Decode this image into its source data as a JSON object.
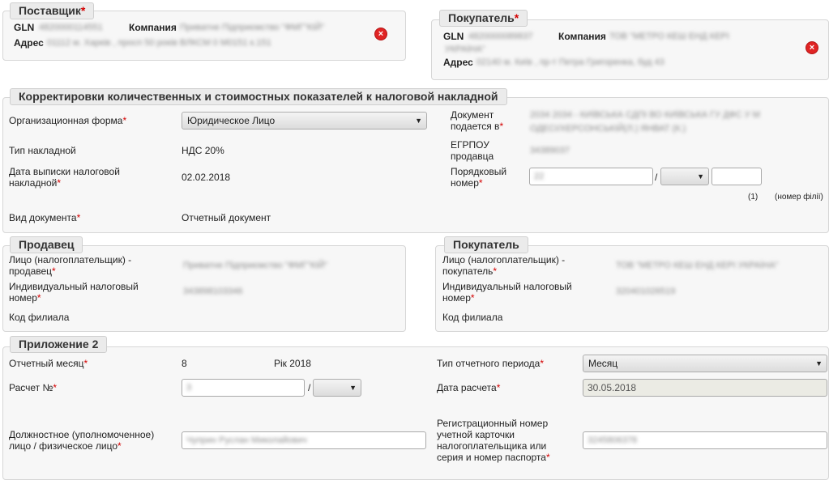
{
  "supplier": {
    "legend": "Поставщик",
    "gln_label": "GLN",
    "gln_value": "4820000114551",
    "company_label": "Компания",
    "company_value": "Приватне Підприємство \"ФМГ\"КІЙ\"",
    "address_label": "Адрес",
    "address_value": "01112 м. Харків , просп 50 років ВЛКСМ 0 М0151 к.151"
  },
  "buyer_top": {
    "legend": "Покупатель",
    "gln_label": "GLN",
    "gln_value": "4820000089837",
    "company_label": "Компания",
    "company_value": "ТОВ \"МЕТРО КЕШ ЕНД КЕРІ",
    "company_value2": "УКРАЇНА\"",
    "address_label": "Адрес",
    "address_value": "02140 м. Київ , пр-т Петра Григоренка, буд 43"
  },
  "corrections": {
    "legend": "Корректировки количественных и стоимостных показателей к налоговой накладной",
    "org_form_label": "Организационная форма",
    "org_form_value": "Юридическое Лицо",
    "invoice_type_label": "Тип накладной",
    "invoice_type_value": "НДС 20%",
    "issue_date_label1": "Дата выписки налоговой",
    "issue_date_label2": "накладной",
    "issue_date_value": "02.02.2018",
    "doc_type_label": "Вид документа",
    "doc_type_value": "Отчетный документ",
    "submitted_label1": "Документ",
    "submitted_label2": "подается в",
    "submitted_value1": "2034 2034 - КИЇВСЬКА СДПІ ВО КИЇВСЬКА ГУ ДФС У М",
    "submitted_value2": "ОДЕСІ/ХЕРСОНСЬКІЙ(Л.) ЯНВАТ (К.)",
    "edrpou_label1": "ЕГРПОУ",
    "edrpou_label2": "продавца",
    "edrpou_value": "34389037",
    "serial_label1": "Порядковый",
    "serial_label2": "номер",
    "serial_value": "22",
    "serial_sep": "/",
    "hint1": "(1)",
    "hint2": "(номер філії)"
  },
  "seller": {
    "legend": "Продавец",
    "person_label1": "Лицо (налогоплательщик) -",
    "person_label2": "продавец",
    "person_value": "Приватне Підприємство \"ФМГ\"КІЙ\"",
    "tax_label1": "Индивидуальный налоговый",
    "tax_label2": "номер",
    "tax_value": "343898103346",
    "branch_label": "Код филиала"
  },
  "buyer": {
    "legend": "Покупатель",
    "person_label1": "Лицо (налогоплательщик) -",
    "person_label2": "покупатель",
    "person_value": "ТОВ \"МЕТРО КЕШ ЕНД КЕРІ УКРАЇНА\"",
    "tax_label1": "Индивидуальный налоговый",
    "tax_label2": "номер",
    "tax_value": "320401026519",
    "branch_label": "Код филиала"
  },
  "appendix": {
    "legend": "Приложение 2",
    "month_label": "Отчетный месяц",
    "month_value": "8",
    "year_value": "Рік 2018",
    "period_label": "Тип отчетного периода",
    "period_value": "Месяц",
    "calc_label": "Расчет №",
    "calc_value": "3",
    "calc_sep": "/",
    "calc_date_label": "Дата расчета",
    "calc_date_value": "30.05.2018",
    "official_label1": "Должностное (уполномоченное)",
    "official_label2": "лицо / физическое лицо",
    "official_value": "Чуприн Руслан Миколайович",
    "reg_label1": "Регистрационный номер",
    "reg_label2": "учетной карточки",
    "reg_label3": "налогоплательщика или",
    "reg_label4": "серия и номер паспорта",
    "reg_value": "3245806378"
  },
  "icons": {
    "remove": "remove-circle-icon",
    "dropdown": "chevron-down-icon"
  },
  "colors": {
    "required": "#d40000",
    "remove": "#e02424",
    "panel": "#f7f7f7"
  }
}
